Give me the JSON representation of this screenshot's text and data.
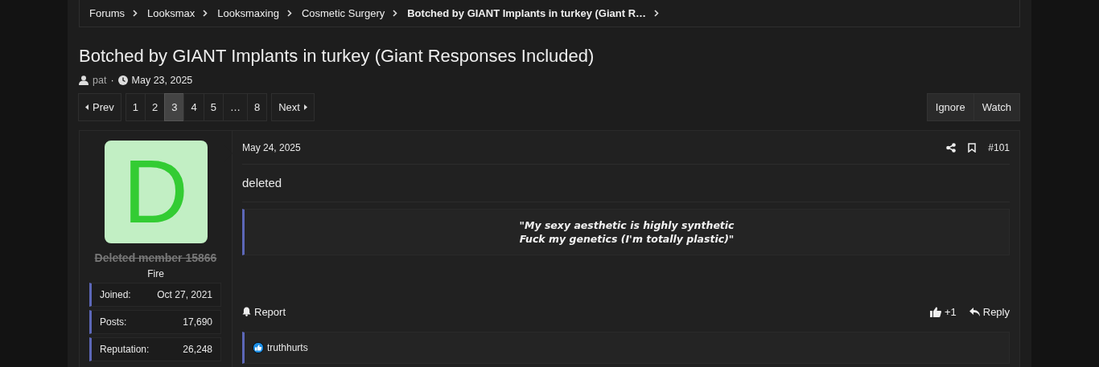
{
  "breadcrumb": [
    {
      "label": "Forums",
      "current": false
    },
    {
      "label": "Looksmax",
      "current": false
    },
    {
      "label": "Looksmaxing",
      "current": false
    },
    {
      "label": "Cosmetic Surgery",
      "current": false
    },
    {
      "label": "Botched by GIANT Implants in turkey (Giant R…",
      "current": true
    }
  ],
  "thread": {
    "title": "Botched by GIANT Implants in turkey (Giant Responses Included)",
    "author": "pat",
    "separator": "·",
    "date": "May 23, 2025"
  },
  "pagination": {
    "prev": "Prev",
    "next": "Next",
    "pages": [
      {
        "label": "1",
        "selected": false
      },
      {
        "label": "2",
        "selected": false
      },
      {
        "label": "3",
        "selected": true
      },
      {
        "label": "4",
        "selected": false
      },
      {
        "label": "5",
        "selected": false
      },
      {
        "label": "…",
        "selected": false
      },
      {
        "label": "8",
        "selected": false
      }
    ]
  },
  "thread_actions": [
    "Ignore",
    "Watch"
  ],
  "post": {
    "user": {
      "avatar_letter": "D",
      "name": "Deleted member 15866",
      "deleted": true,
      "title": "Fire",
      "stats": [
        {
          "label": "Joined:",
          "value": "Oct 27, 2021"
        },
        {
          "label": "Posts:",
          "value": "17,690"
        },
        {
          "label": "Reputation:",
          "value": "26,248"
        }
      ]
    },
    "date": "May 24, 2025",
    "number": "#101",
    "body": "deleted",
    "quote_lines": [
      "\"My sexy aesthetic is highly synthetic",
      "Fuck my genetics (I'm totally plastic)\""
    ],
    "report": "Report",
    "like_count": "+1",
    "reply": "Reply",
    "reactions": [
      "truthhurts"
    ]
  }
}
